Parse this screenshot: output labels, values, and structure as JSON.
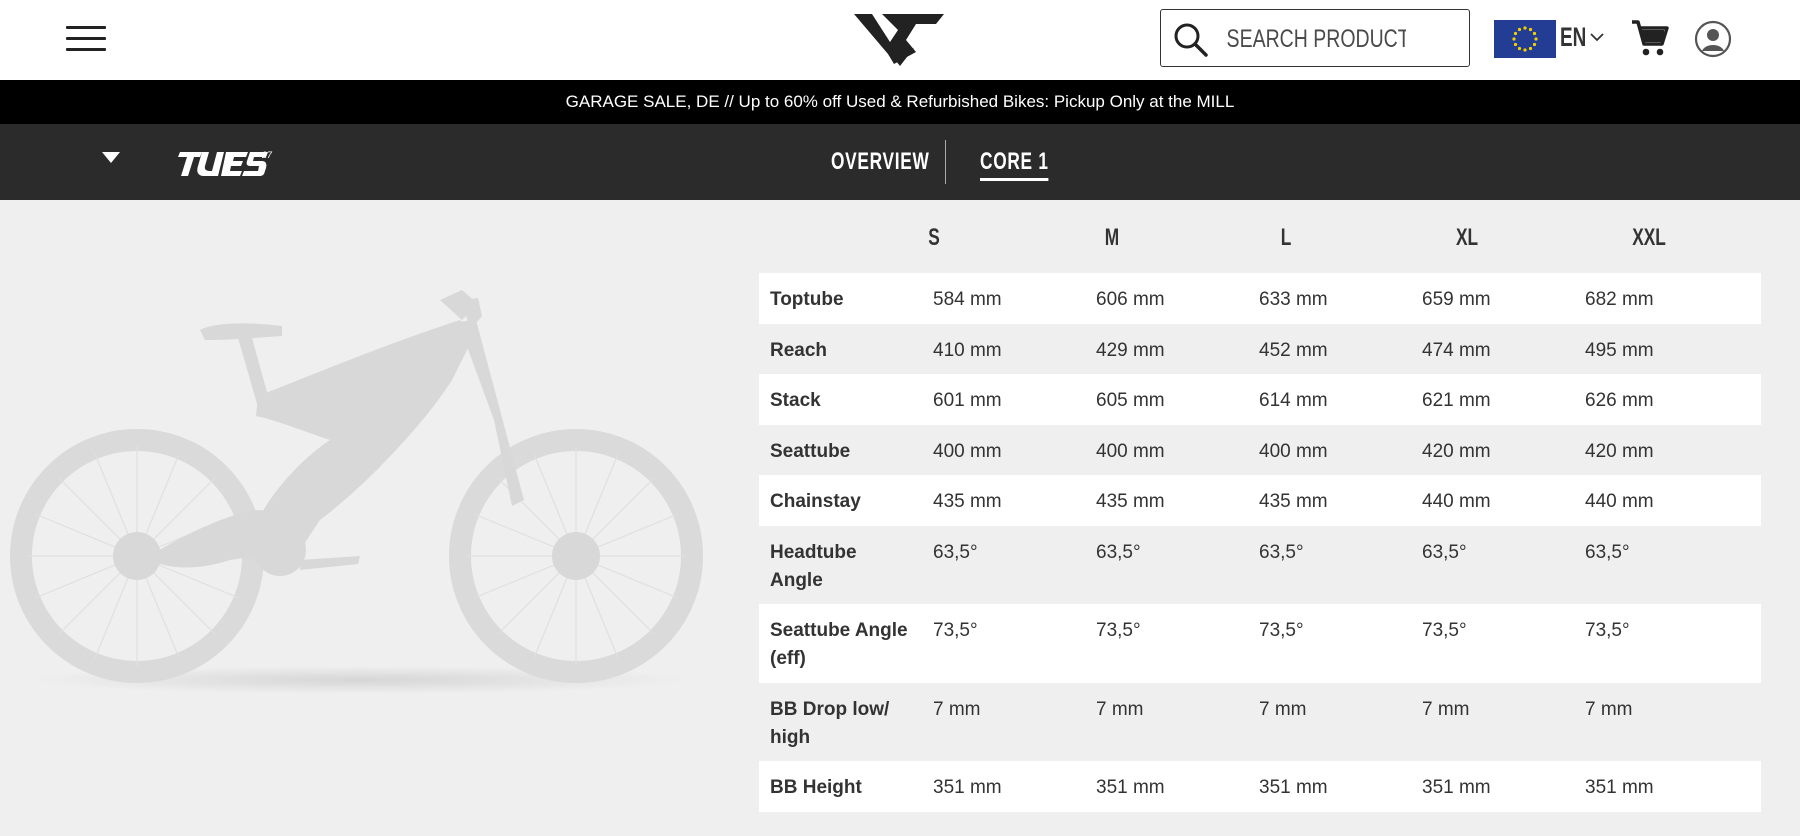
{
  "header": {
    "search_placeholder": "SEARCH PRODUCTS",
    "language": "EN",
    "brand_color": "#233d94"
  },
  "promo": {
    "text": "GARAGE SALE, DE // Up to 60% off Used & Refurbished Bikes: Pickup Only at the MILL"
  },
  "subnav": {
    "tabs": [
      "OVERVIEW",
      "CORE 1"
    ],
    "active_tab": "CORE 1"
  },
  "geometry": {
    "sizes": [
      "S",
      "M",
      "L",
      "XL",
      "XXL"
    ],
    "rows": [
      {
        "label": "Toptube",
        "values": [
          "584 mm",
          "606 mm",
          "633 mm",
          "659 mm",
          "682 mm"
        ]
      },
      {
        "label": "Reach",
        "values": [
          "410 mm",
          "429 mm",
          "452 mm",
          "474 mm",
          "495 mm"
        ]
      },
      {
        "label": "Stack",
        "values": [
          "601 mm",
          "605 mm",
          "614 mm",
          "621 mm",
          "626 mm"
        ]
      },
      {
        "label": "Seattube",
        "values": [
          "400 mm",
          "400 mm",
          "400 mm",
          "420 mm",
          "420 mm"
        ]
      },
      {
        "label": "Chainstay",
        "values": [
          "435 mm",
          "435 mm",
          "435 mm",
          "440 mm",
          "440 mm"
        ]
      },
      {
        "label": "Headtube Angle",
        "values": [
          "63,5°",
          "63,5°",
          "63,5°",
          "63,5°",
          "63,5°"
        ]
      },
      {
        "label": "Seattube Angle (eff)",
        "values": [
          "73,5°",
          "73,5°",
          "73,5°",
          "73,5°",
          "73,5°"
        ]
      },
      {
        "label": "BB Drop low/ high",
        "values": [
          "7 mm",
          "7 mm",
          "7 mm",
          "7 mm",
          "7 mm"
        ]
      },
      {
        "label": "BB Height",
        "values": [
          "351 mm",
          "351 mm",
          "351 mm",
          "351 mm",
          "351 mm"
        ]
      }
    ]
  }
}
